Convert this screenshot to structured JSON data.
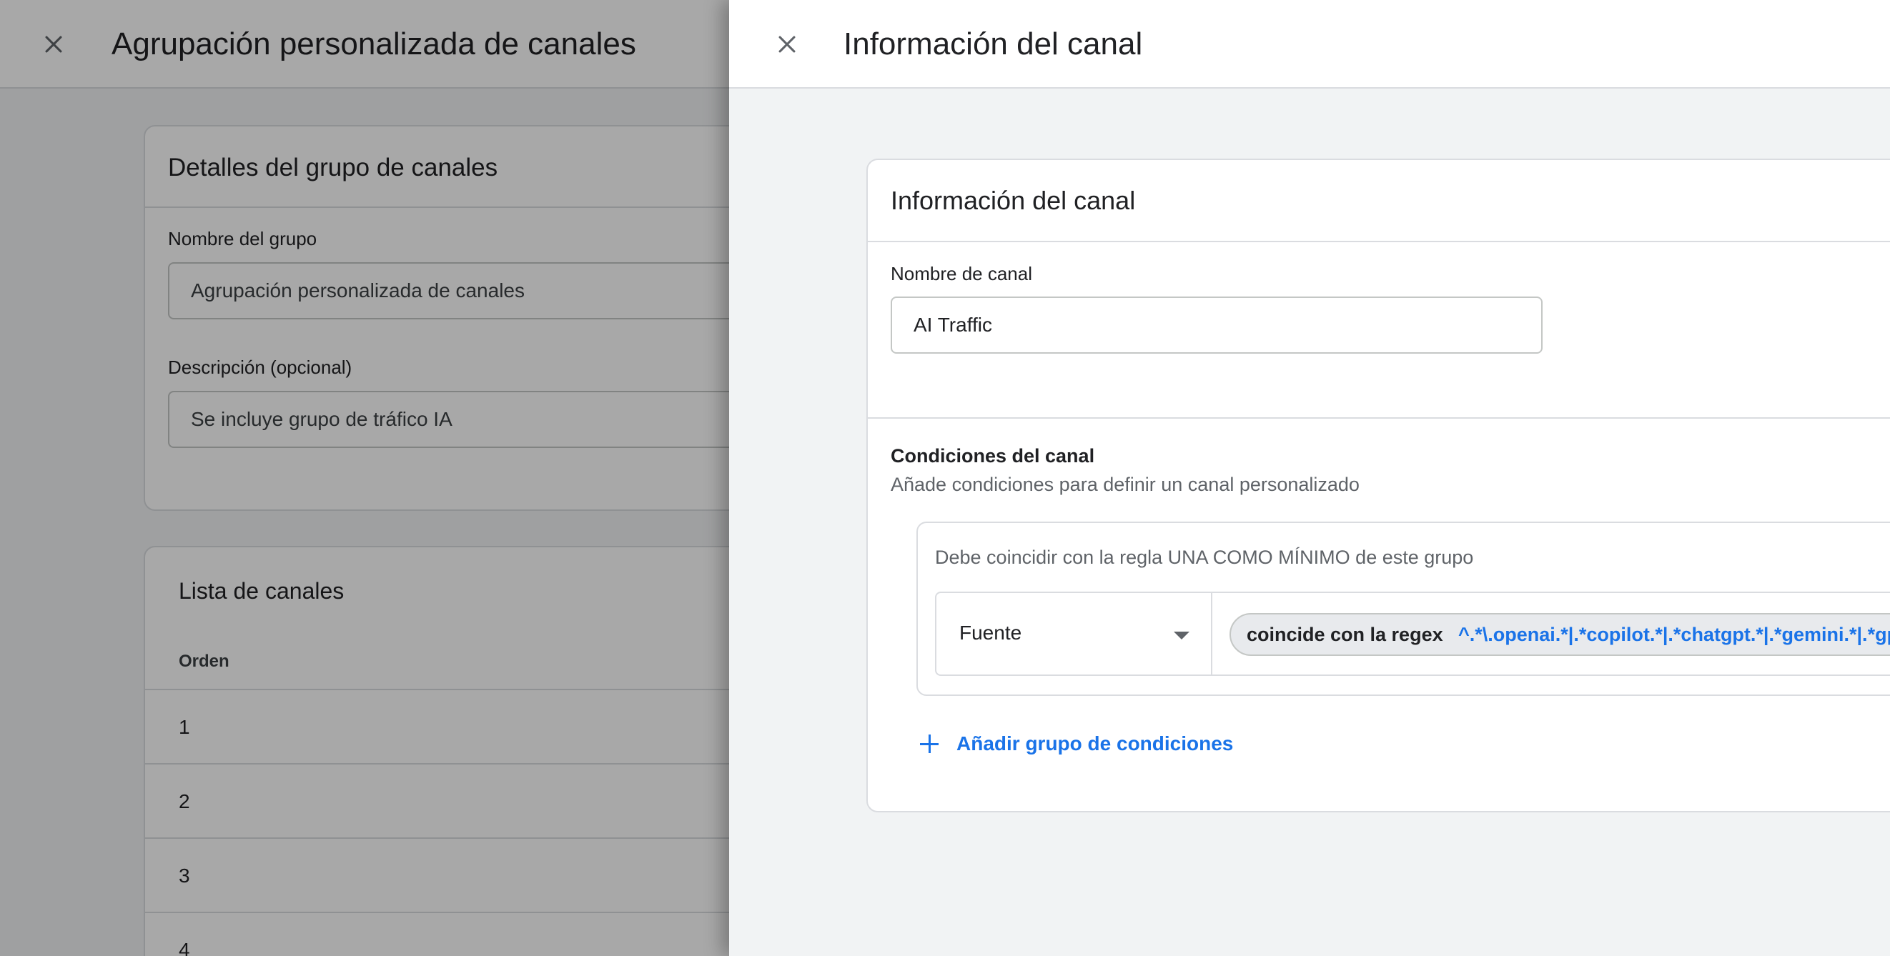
{
  "background": {
    "header": {
      "title": "Agrupación personalizada de canales"
    },
    "details_card": {
      "title": "Detalles del grupo de canales",
      "group_name_label": "Nombre del grupo",
      "group_name_value": "Agrupación personalizada de canales",
      "description_label": "Descripción (opcional)",
      "description_value": "Se incluye grupo de tráfico IA"
    },
    "channels_card": {
      "title": "Lista de canales",
      "order_header": "Orden",
      "rows": [
        "1",
        "2",
        "3",
        "4"
      ]
    }
  },
  "panel": {
    "header": {
      "title": "Información del canal"
    },
    "card": {
      "title": "Información del canal",
      "channel_name_label": "Nombre de canal",
      "channel_name_value": "AI Traffic",
      "conditions_title": "Condiciones del canal",
      "conditions_subtitle": "Añade condiciones para definir un canal personalizado",
      "group": {
        "description": "Debe coincidir con la regla UNA COMO MÍNIMO de este grupo",
        "dimension": "Fuente",
        "operator": "coincide con la regex",
        "value": "^.*\\.openai.*|.*copilot.*|.*chatgpt.*|.*gemini.*|.*gpt.*|.*neeva.*|.*writesonic.*|.*nimble.*|.*outrider.*|.*perplexity.*"
      },
      "add_group_label": "Añadir grupo de condiciones"
    }
  },
  "colors": {
    "accent": "#1a73e8",
    "border": "#dadce0",
    "panel_background": "#f1f3f4"
  }
}
